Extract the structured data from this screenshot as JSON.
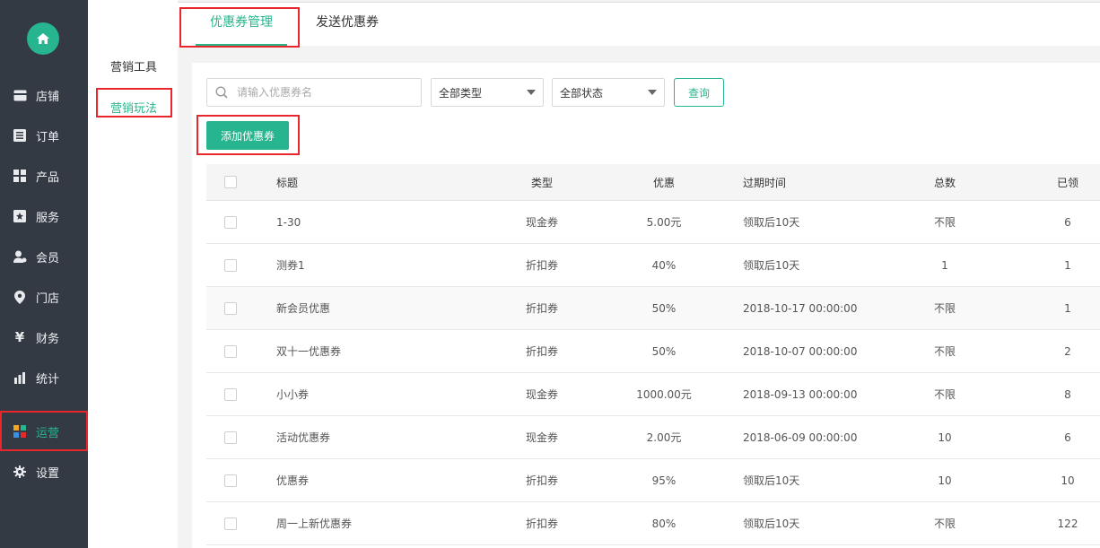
{
  "nav": {
    "items": [
      {
        "label": "店铺",
        "icon": "shop-icon"
      },
      {
        "label": "订单",
        "icon": "order-list-icon"
      },
      {
        "label": "产品",
        "icon": "product-grid-icon"
      },
      {
        "label": "服务",
        "icon": "service-icon"
      },
      {
        "label": "会员",
        "icon": "member-icon"
      },
      {
        "label": "门店",
        "icon": "location-pin-icon"
      },
      {
        "label": "财务",
        "icon": "yen-icon"
      },
      {
        "label": "统计",
        "icon": "bar-stats-icon"
      },
      {
        "label": "运营",
        "icon": "operations-icon"
      },
      {
        "label": "设置",
        "icon": "gear-icon"
      }
    ],
    "active": "运营"
  },
  "subnav": {
    "title": "营销工具",
    "item": "营销玩法"
  },
  "tabs": [
    {
      "label": "优惠券管理"
    },
    {
      "label": "发送优惠券"
    }
  ],
  "filters": {
    "search_placeholder": "请输入优惠券名",
    "type_select": "全部类型",
    "status_select": "全部状态",
    "query_label": "查询",
    "add_label": "添加优惠券"
  },
  "table": {
    "headers": {
      "title": "标题",
      "type": "类型",
      "discount": "优惠",
      "expiry": "过期时间",
      "total": "总数",
      "claimed": "已领"
    },
    "rows": [
      {
        "title": "1-30",
        "type": "现金券",
        "discount": "5.00元",
        "expiry": "领取后10天",
        "total": "不限",
        "claimed": "6"
      },
      {
        "title": "测券1",
        "type": "折扣券",
        "discount": "40%",
        "expiry": "领取后10天",
        "total": "1",
        "claimed": "1"
      },
      {
        "title": "新会员优惠",
        "type": "折扣券",
        "discount": "50%",
        "expiry": "2018-10-17 00:00:00",
        "total": "不限",
        "claimed": "1"
      },
      {
        "title": "双十一优惠券",
        "type": "折扣券",
        "discount": "50%",
        "expiry": "2018-10-07 00:00:00",
        "total": "不限",
        "claimed": "2"
      },
      {
        "title": "小小券",
        "type": "现金券",
        "discount": "1000.00元",
        "expiry": "2018-09-13 00:00:00",
        "total": "不限",
        "claimed": "8"
      },
      {
        "title": "活动优惠券",
        "type": "现金券",
        "discount": "2.00元",
        "expiry": "2018-06-09 00:00:00",
        "total": "10",
        "claimed": "6"
      },
      {
        "title": "优惠券",
        "type": "折扣券",
        "discount": "95%",
        "expiry": "领取后10天",
        "total": "10",
        "claimed": "10"
      },
      {
        "title": "周一上新优惠券",
        "type": "折扣券",
        "discount": "80%",
        "expiry": "领取后10天",
        "total": "不限",
        "claimed": "122"
      }
    ]
  },
  "colors": {
    "accent": "#26b58e",
    "nav_bg": "#343a44",
    "highlight": "#e8262b"
  }
}
